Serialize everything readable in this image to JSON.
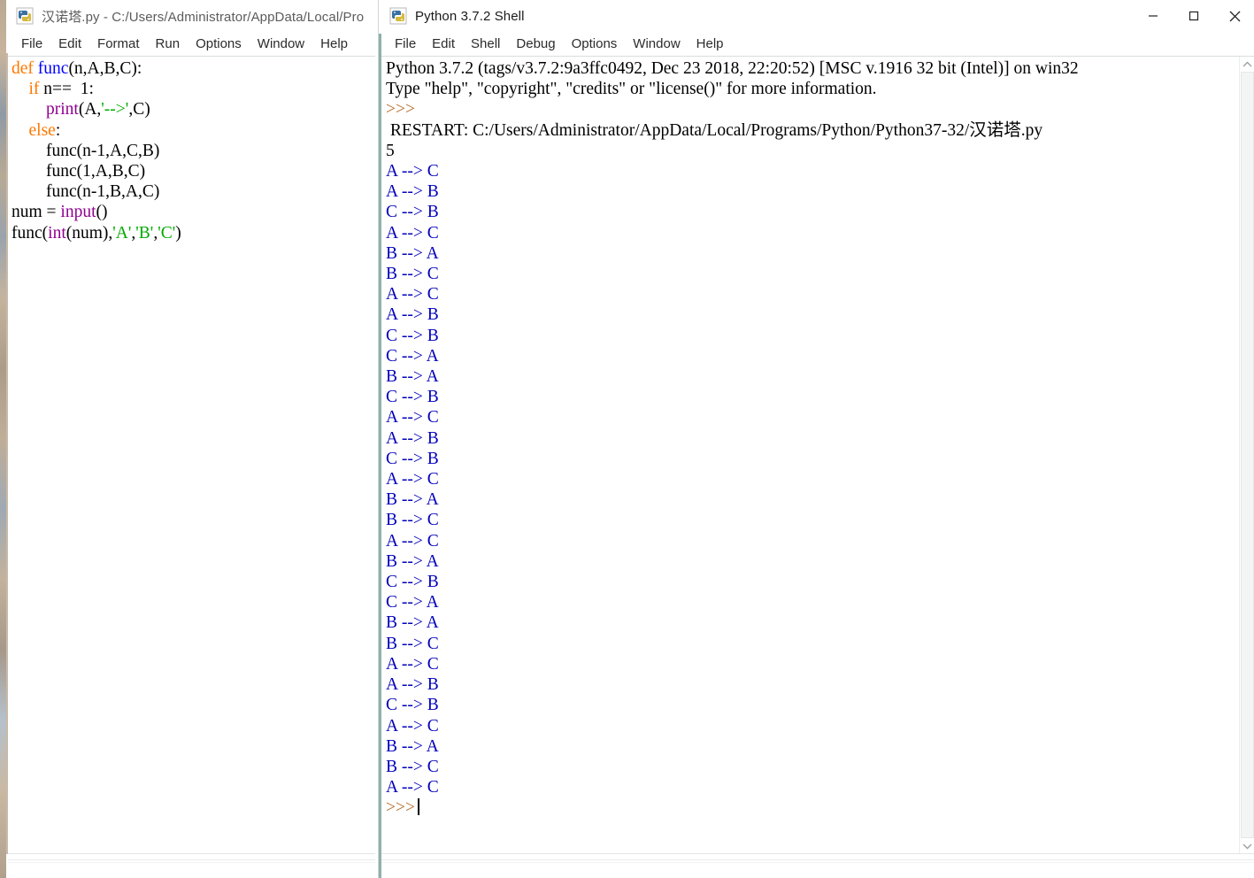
{
  "editor_window": {
    "icon": "python-idle-icon",
    "title": "汉诺塔.py - C:/Users/Administrator/AppData/Local/Pro",
    "menu": [
      "File",
      "Edit",
      "Format",
      "Run",
      "Options",
      "Window",
      "Help"
    ],
    "code": {
      "line1": {
        "kw": "def",
        "fn": "func",
        "rest": "(n,A,B,C):"
      },
      "line2": {
        "indent": "    ",
        "kw": "if",
        "rest": " n==  1:"
      },
      "line3": {
        "indent": "        ",
        "builtin": "print",
        "open": "(A,",
        "str": "'-->'",
        "close": ",C)"
      },
      "line4": {
        "indent": "    ",
        "kw": "else",
        "rest": ":"
      },
      "line5": "        func(n-1,A,C,B)",
      "line6": "        func(1,A,B,C)",
      "line7": "        func(n-1,B,A,C)",
      "line8": {
        "pre": "num = ",
        "builtin": "input",
        "post": "()"
      },
      "line9": {
        "pre": "func(",
        "builtin": "int",
        "mid": "(num),",
        "s1": "'A'",
        "c1": ",",
        "s2": "'B'",
        "c2": ",",
        "s3": "'C'",
        "post": ")"
      }
    }
  },
  "shell_window": {
    "icon": "python-idle-icon",
    "title": "Python 3.7.2 Shell",
    "menu": [
      "File",
      "Edit",
      "Shell",
      "Debug",
      "Options",
      "Window",
      "Help"
    ],
    "window_buttons": {
      "minimize": "minimize-icon",
      "maximize": "maximize-icon",
      "close": "close-icon"
    },
    "banner_line1": "Python 3.7.2 (tags/v3.7.2:9a3ffc0492, Dec 23 2018, 22:20:52) [MSC v.1916 32 bit (Intel)] on win32",
    "banner_line2": "Type \"help\", \"copyright\", \"credits\" or \"license()\" for more information.",
    "prompt": ">>>",
    "restart_line": " RESTART: C:/Users/Administrator/AppData/Local/Programs/Python/Python37-32/汉诺塔.py",
    "user_input": "5",
    "moves": [
      "A --> C",
      "A --> B",
      "C --> B",
      "A --> C",
      "B --> A",
      "B --> C",
      "A --> C",
      "A --> B",
      "C --> B",
      "C --> A",
      "B --> A",
      "C --> B",
      "A --> C",
      "A --> B",
      "C --> B",
      "A --> C",
      "B --> A",
      "B --> C",
      "A --> C",
      "B --> A",
      "C --> B",
      "C --> A",
      "B --> A",
      "B --> C",
      "A --> C",
      "A --> B",
      "C --> B",
      "A --> C",
      "B --> A",
      "B --> C",
      "A --> C"
    ],
    "final_prompt": ">>>"
  },
  "colors": {
    "keyword": "#ff7700",
    "definition": "#0000ff",
    "builtin": "#900090",
    "string": "#00aa00",
    "stdout": "#0000bb",
    "prompt": "#b5651d",
    "editor_accent": "#c9b9a7",
    "shell_accent": "#8fb0ad"
  }
}
